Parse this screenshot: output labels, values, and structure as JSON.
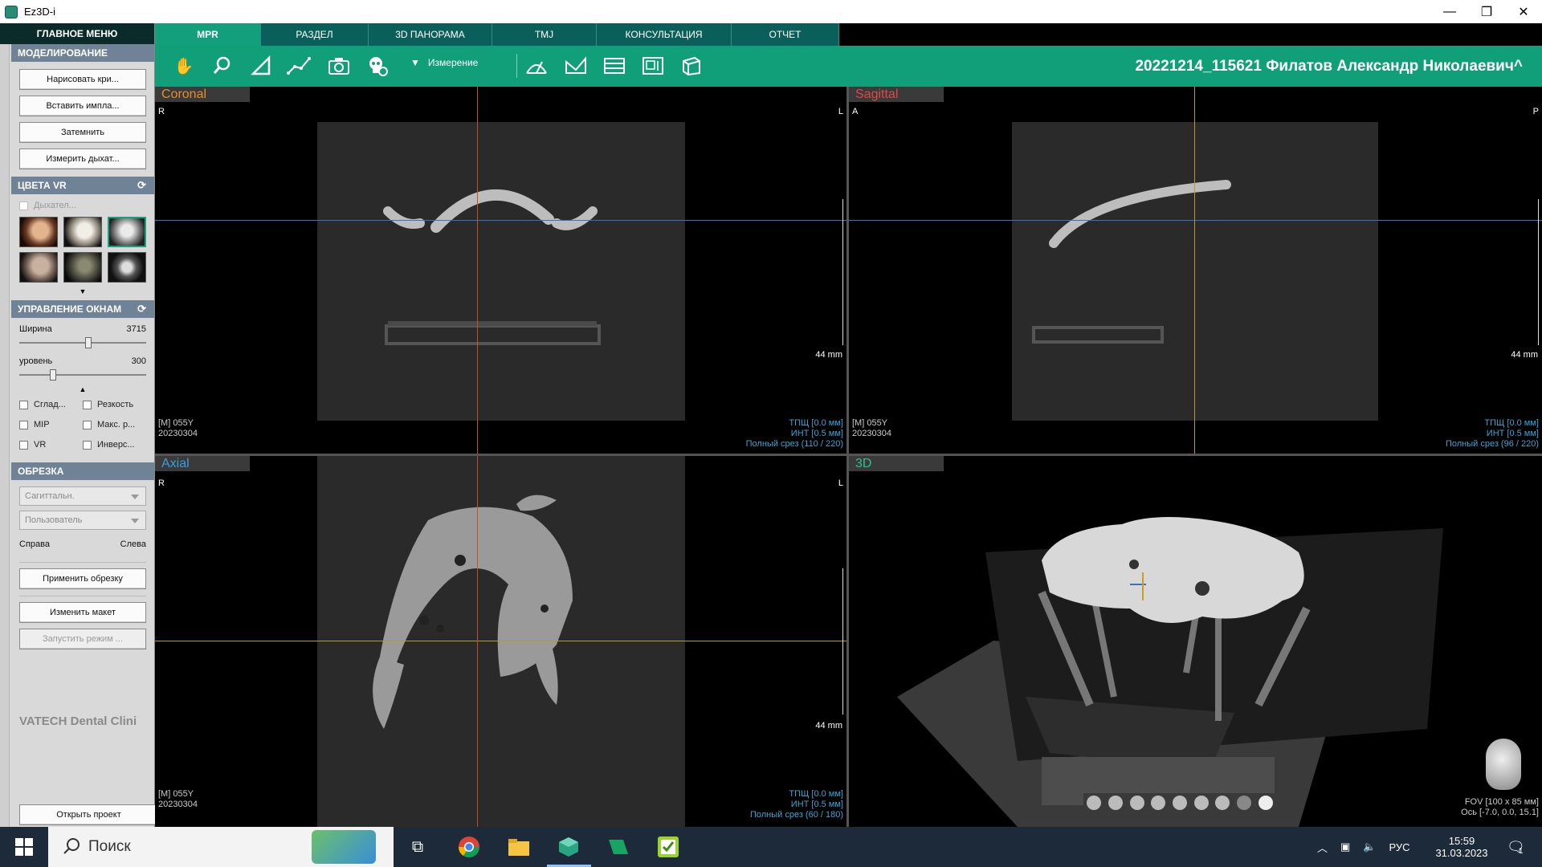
{
  "window": {
    "title": "Ez3D-i",
    "minimize": "—",
    "maximize": "❐",
    "close": "✕"
  },
  "sidebar": {
    "main_menu": "ГЛАВНОЕ МЕНЮ",
    "modeling": {
      "header": "МОДЕЛИРОВАНИЕ",
      "buttons": [
        "Нарисовать кри...",
        "Вставить импла...",
        "Затемнить",
        "Измерить дыхат..."
      ]
    },
    "vr_colors": {
      "header": "ЦВЕТА VR",
      "breath_label": "Дыхател...",
      "preset_icons": [
        "skull-color-preset-icon",
        "skull-bone-preset-icon",
        "skull-xray-preset-icon",
        "head-skin-preset-icon",
        "skull-dark-preset-icon",
        "skull-mip-preset-icon"
      ]
    },
    "window_ctrl": {
      "header": "УПРАВЛЕНИЕ ОКНАМ",
      "width_label": "Ширина",
      "width_value": "3715",
      "level_label": "уровень",
      "level_value": "300",
      "checks": [
        "Сглад...",
        "Резкость",
        "MIP",
        "Макс. р...",
        "VR",
        "Инверс..."
      ]
    },
    "crop": {
      "header": "ОБРЕЗКА",
      "dropdown1": "Сагиттальн.",
      "dropdown2": "Пользователь",
      "right_label": "Справа",
      "left_label": "Слева",
      "apply": "Применить обрезку"
    },
    "change_layout": "Изменить макет",
    "launch_mode": "Запустить режим ...",
    "brand": "VATECH Dental Clini",
    "open_project": "Открыть проект"
  },
  "tabs": [
    "MPR",
    "РАЗДЕЛ",
    "3D ПАНОРАМА",
    "TMJ",
    "КОНСУЛЬТАЦИЯ",
    "ОТЧЕТ"
  ],
  "toolbar": {
    "measure_label": "Измерение",
    "patient": "20221214_115621 Филатов Александр Николаевич^"
  },
  "views": {
    "coronal": {
      "label": "Coronal",
      "left": "R",
      "right": "L",
      "scale": "44 mm",
      "info_l1": "[M] 055Y",
      "info_l2": "20230304",
      "info_r1": "ТПЩ [0.0 мм]",
      "info_r2": "ИНТ [0.5 мм]",
      "info_r3": "Полный срез (110 / 220)"
    },
    "sagittal": {
      "label": "Sagittal",
      "left": "A",
      "right": "P",
      "scale": "44 mm",
      "info_l1": "[M] 055Y",
      "info_l2": "20230304",
      "info_r1": "ТПЩ [0.0 мм]",
      "info_r2": "ИНТ [0.5 мм]",
      "info_r3": "Полный срез (96 / 220)"
    },
    "axial": {
      "label": "Axial",
      "left": "R",
      "right": "L",
      "scale": "44 mm",
      "info_l1": "[M] 055Y",
      "info_l2": "20230304",
      "info_r1": "ТПЩ [0.0 мм]",
      "info_r2": "ИНТ [0.5 мм]",
      "info_r3": "Полный срез (60 / 180)"
    },
    "view3d": {
      "label": "3D",
      "fov": "FOV [100 x 85 мм]",
      "axis": "Ось [-7.0, 0.0, 15.1]"
    }
  },
  "taskbar": {
    "search": "Поиск",
    "lang": "РУС",
    "time": "15:59",
    "date": "31.03.2023",
    "notif_count": "1"
  }
}
